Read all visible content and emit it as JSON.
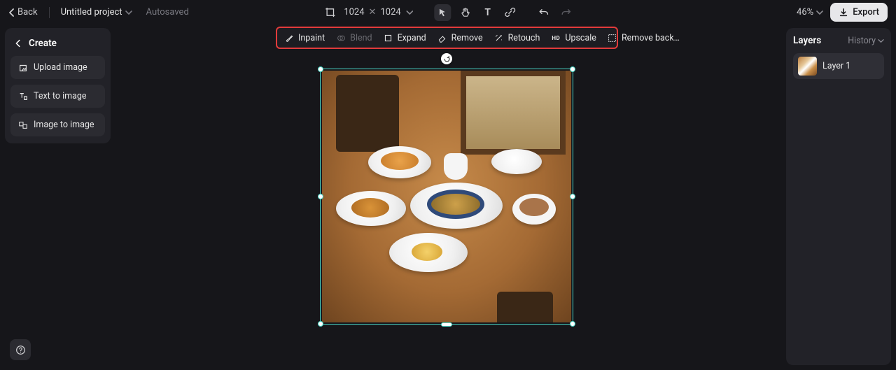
{
  "header": {
    "back_label": "Back",
    "project_title": "Untitled project",
    "autosave_label": "Autosaved",
    "canvas_width": "1024",
    "canvas_height": "1024",
    "zoom_label": "46%",
    "export_label": "Export"
  },
  "action_toolbar": {
    "inpaint": "Inpaint",
    "blend": "Blend",
    "expand": "Expand",
    "remove": "Remove",
    "retouch": "Retouch",
    "upscale": "Upscale",
    "remove_bg": "Remove back…"
  },
  "left_panel": {
    "title": "Create",
    "upload": "Upload image",
    "text_to_image": "Text to image",
    "image_to_image": "Image to image"
  },
  "right_panel": {
    "title": "Layers",
    "history": "History",
    "layer1": "Layer 1"
  }
}
